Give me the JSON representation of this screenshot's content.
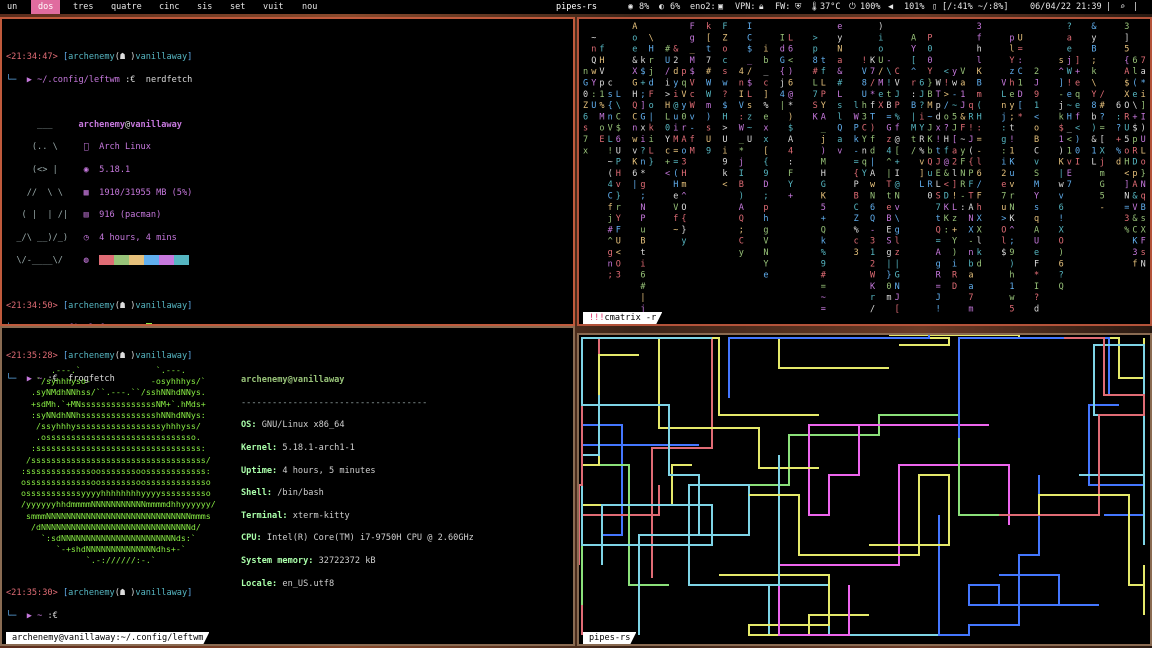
{
  "bar": {
    "workspaces": [
      "un",
      "dos",
      "tres",
      "quatre",
      "cinc",
      "sis",
      "set",
      "vuit",
      "nou"
    ],
    "active_workspace": "dos",
    "window_title": "pipes-rs",
    "status": {
      "cpu": "8%",
      "mem": "6%",
      "net_iface": "eno2:",
      "vpn": "VPN:",
      "fw": "FW:",
      "temp": "37°C",
      "battery": "100%",
      "volume": "101%",
      "disk": "[/:41% ~/:8%]",
      "datetime": "06/04/22 21:39"
    }
  },
  "colors": {
    "border_active": "#c05a3c",
    "border": "#8a6b52",
    "accent_ws": "#e06c9f"
  },
  "term1": {
    "prompt1_time": "<21:34:47>",
    "user": "archenemy",
    "host": "vanillaway",
    "cwd": "~/.config/leftwm",
    "arrow": ":€",
    "cmd1": "nerdfetch",
    "prompt2_time": "<21:34:50>",
    "nf": {
      "title_user": "archenemy",
      "title_host": "vanillaway",
      "os": "Arch Linux",
      "kernel": "5.18.1",
      "memory": "1910/31955 MB (5%)",
      "packages": "916 (pacman)",
      "uptime": "4 hours, 4 mins"
    },
    "tab": "archenemy@vanillaway:~/.config/leftwm"
  },
  "term2": {
    "prompt1_time": "<21:35:28>",
    "cwd": "~",
    "cmd1": "frogfetch",
    "prompt2_time": "<21:35:30>",
    "ff": {
      "title": "archenemy@vanillaway",
      "separator": "------------------------------------",
      "rows": [
        {
          "k": "OS:",
          "v": "GNU/Linux x86_64"
        },
        {
          "k": "Kernel:",
          "v": "5.18.1-arch1-1"
        },
        {
          "k": "Uptime:",
          "v": "4 hours, 5 minutes"
        },
        {
          "k": "Shell:",
          "v": "/bin/bash"
        },
        {
          "k": "Terminal:",
          "v": "xterm-kitty"
        },
        {
          "k": "CPU:",
          "v": "Intel(R) Core(TM) i7-9750H CPU @ 2.60GHz"
        },
        {
          "k": "System memory:",
          "v": "32722372 kB"
        },
        {
          "k": "Locale:",
          "v": "en_US.utf8"
        }
      ]
    }
  },
  "cmatrix": {
    "tab_bang": "!!!",
    "tab_label": "cmatrix -r"
  },
  "pipes": {
    "tab_label": "pipes-rs"
  }
}
